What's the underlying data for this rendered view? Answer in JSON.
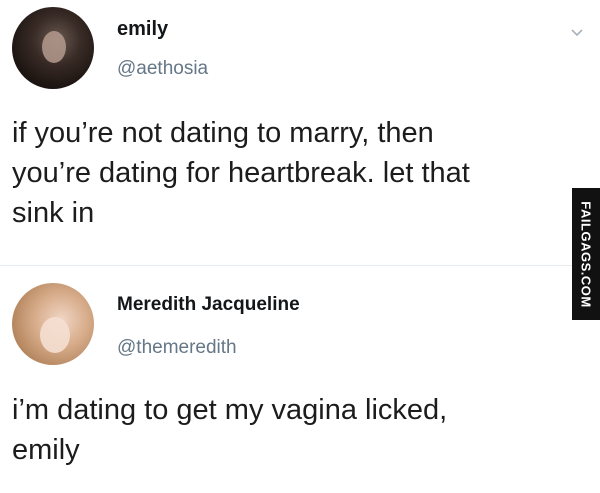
{
  "tweets": [
    {
      "display_name": "emily",
      "handle": "@aethosia",
      "text": "if you’re not dating to marry, then\nyou’re dating for heartbreak. let that\nsink in",
      "avatar_icon": "avatar-photo"
    },
    {
      "display_name": "Meredith Jacqueline",
      "handle": "@themeredith",
      "text": "i’m dating to get my vagina licked,\nemily",
      "avatar_icon": "avatar-photo"
    }
  ],
  "watermark": {
    "text": "FAILGAGS.COM"
  },
  "icons": {
    "menu": "chevron-down-icon"
  },
  "colors": {
    "handle": "#657786",
    "text": "#14171a",
    "divider": "#e6ecf0"
  }
}
